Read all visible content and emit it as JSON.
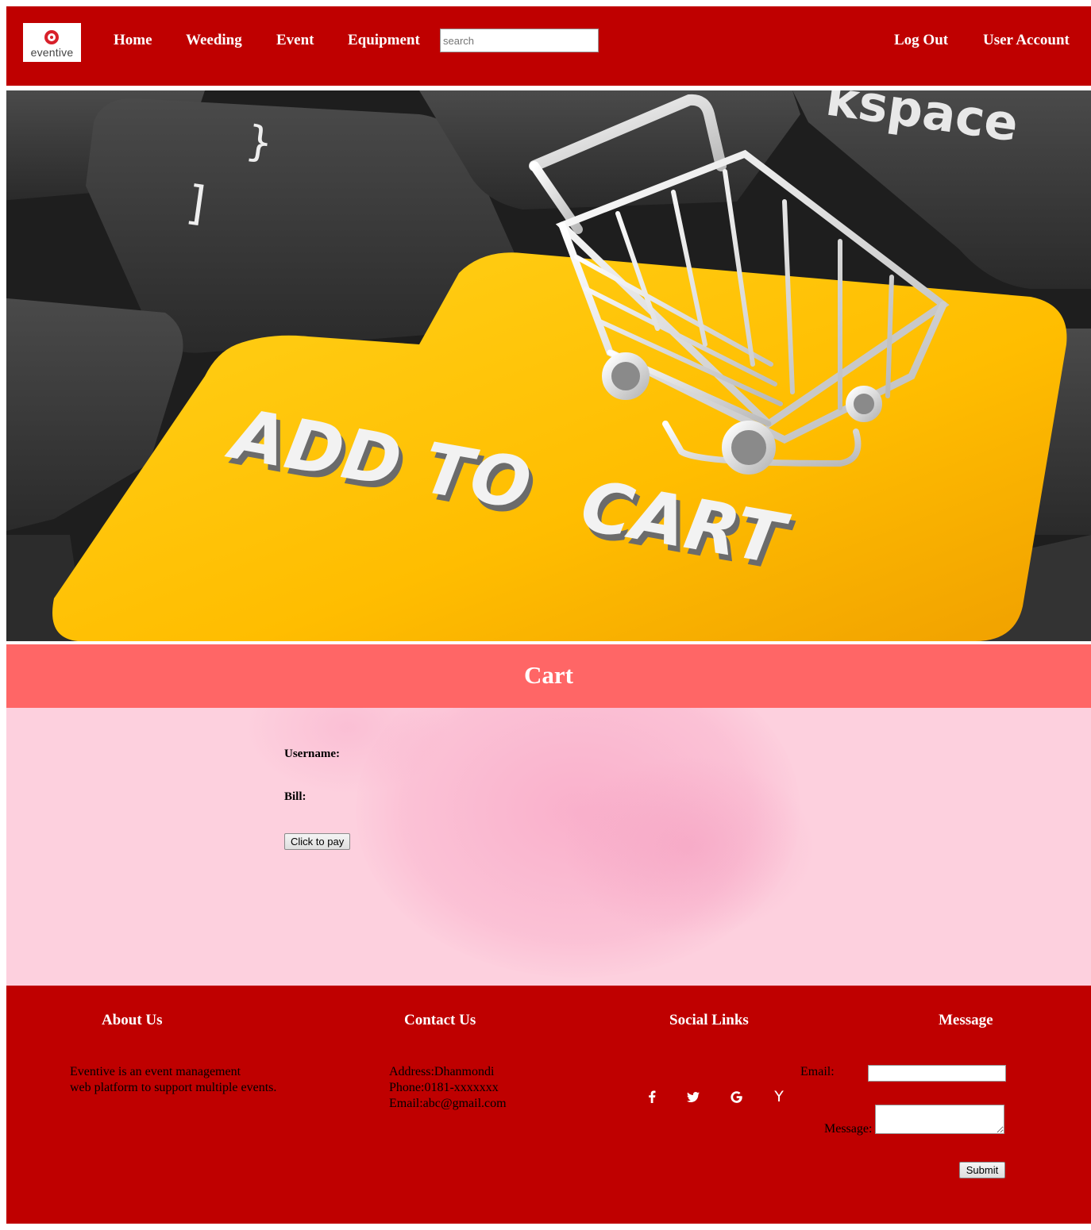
{
  "header": {
    "stray_text": "<",
    "logo_text": "eventive",
    "nav": {
      "home": "Home",
      "wedding": "Weeding",
      "event": "Event",
      "equipment": "Equipment",
      "logout": "Log Out",
      "account": "User Account"
    },
    "search_placeholder": "search"
  },
  "hero": {
    "key_text_top": "ADD TO",
    "key_text_bottom": "CART",
    "backspace_text": "kspace",
    "glyph_brace": "}",
    "glyph_bracket": "]"
  },
  "cart": {
    "title": "Cart",
    "username_label": "Username:",
    "bill_label": "Bill:",
    "pay_button": "Click to pay"
  },
  "footer": {
    "about": {
      "heading": "About Us",
      "line1": "Eventive is an event management",
      "line2": "web platform to support multiple events."
    },
    "contact": {
      "heading": "Contact Us",
      "address": "Address:Dhanmondi",
      "phone": "Phone:0181-xxxxxxx",
      "email": "Email:abc@gmail.com"
    },
    "social": {
      "heading": "Social Links",
      "icons": [
        "facebook-icon",
        "twitter-icon",
        "google-icon",
        "hackernews-icon"
      ]
    },
    "message": {
      "heading": "Message",
      "email_label": "Email:",
      "message_label": "Message:",
      "submit": "Submit"
    }
  },
  "colors": {
    "header_bg": "#bf0000",
    "cart_head_bg": "#ff6666",
    "cart_body_bg": "#fdd0de",
    "footer_bg": "#bf0000",
    "key_yellow": "#ffbf00"
  }
}
